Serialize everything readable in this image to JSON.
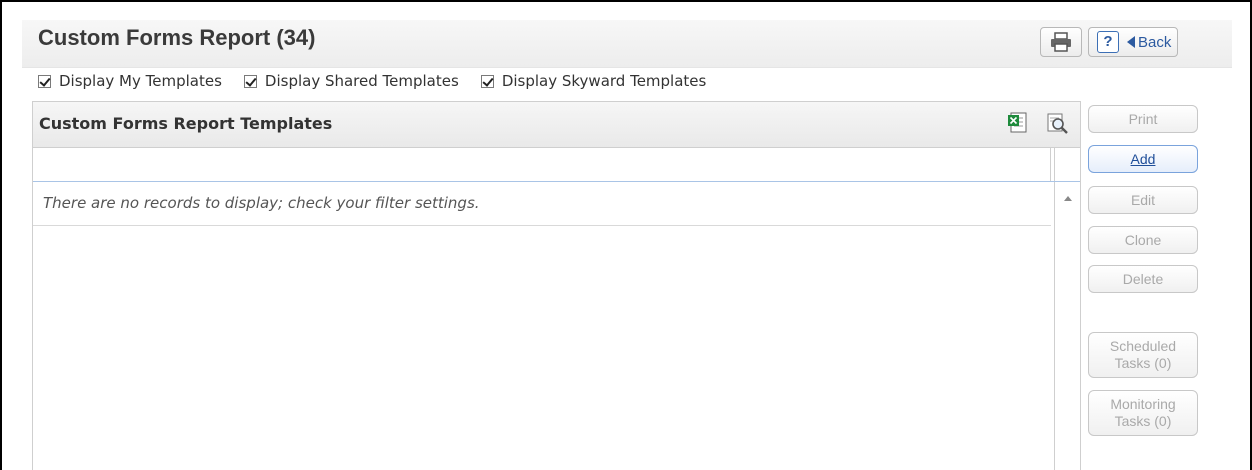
{
  "page": {
    "title": "Custom Forms Report (34)",
    "back_label": "Back",
    "help_label": "?"
  },
  "filters": [
    {
      "label": "Display My Templates",
      "checked": true
    },
    {
      "label": "Display Shared Templates",
      "checked": true
    },
    {
      "label": "Display Skyward Templates",
      "checked": true
    }
  ],
  "grid": {
    "title": "Custom Forms Report Templates",
    "empty_message": "There are no records to display; check your filter settings."
  },
  "actions": {
    "print": "Print",
    "add": "Add",
    "edit": "Edit",
    "clone": "Clone",
    "delete": "Delete",
    "scheduled_tasks": "Scheduled\nTasks (0)",
    "monitoring_tasks": "Monitoring\nTasks (0)"
  },
  "colors": {
    "accent": "#1f4e99",
    "link": "#2c5aa0",
    "disabled_text": "#a9a9a9"
  }
}
